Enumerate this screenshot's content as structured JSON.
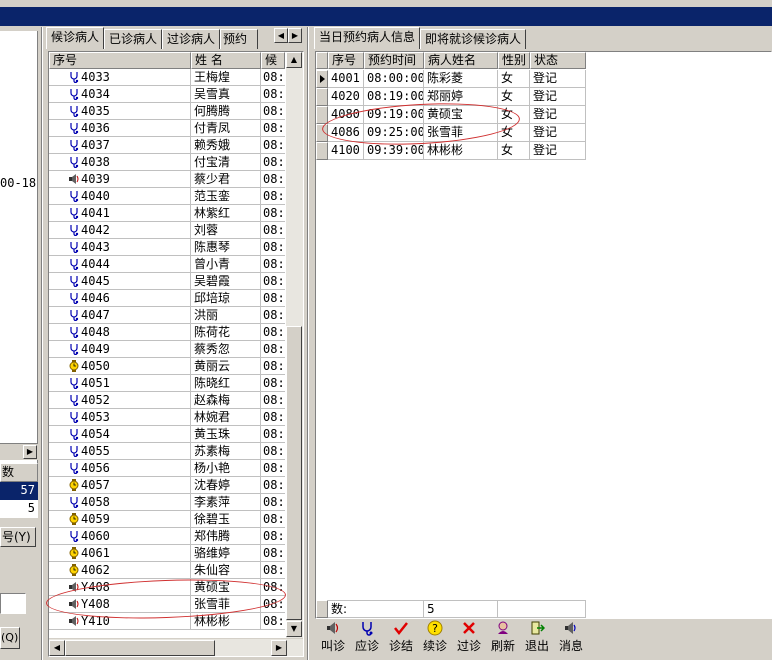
{
  "left_panel": {
    "datetime_fragment": "00-18",
    "count_header": "数",
    "count_value_1": "57",
    "count_value_2": "5",
    "button_1": "号(Y)",
    "button_2": "(Q)"
  },
  "middle": {
    "tabs": [
      "候诊病人",
      "已诊病人",
      "过诊病人",
      "预约"
    ],
    "active_tab": 0,
    "columns": [
      "序号",
      "姓  名",
      "候"
    ],
    "rows": [
      {
        "no": "4033",
        "name": "王梅煌",
        "time": "08:",
        "icon": "stethoscope"
      },
      {
        "no": "4034",
        "name": "吴雪真",
        "time": "08:",
        "icon": "stethoscope"
      },
      {
        "no": "4035",
        "name": "何腾腾",
        "time": "08:",
        "icon": "stethoscope"
      },
      {
        "no": "4036",
        "name": "付青凤",
        "time": "08:",
        "icon": "stethoscope"
      },
      {
        "no": "4037",
        "name": "赖秀娥",
        "time": "08:",
        "icon": "stethoscope"
      },
      {
        "no": "4038",
        "name": "付宝清",
        "time": "08:",
        "icon": "stethoscope"
      },
      {
        "no": "4039",
        "name": "蔡少君",
        "time": "08:",
        "icon": "speaker"
      },
      {
        "no": "4040",
        "name": "范玉銮",
        "time": "08:",
        "icon": "stethoscope"
      },
      {
        "no": "4041",
        "name": "林紫红",
        "time": "08:",
        "icon": "stethoscope"
      },
      {
        "no": "4042",
        "name": "刘蓉",
        "time": "08:",
        "icon": "stethoscope"
      },
      {
        "no": "4043",
        "name": "陈惠琴",
        "time": "08:",
        "icon": "stethoscope"
      },
      {
        "no": "4044",
        "name": "曾小青",
        "time": "08:",
        "icon": "stethoscope"
      },
      {
        "no": "4045",
        "name": "吴碧霞",
        "time": "08:",
        "icon": "stethoscope"
      },
      {
        "no": "4046",
        "name": "邱培琼",
        "time": "08:",
        "icon": "stethoscope"
      },
      {
        "no": "4047",
        "name": "洪丽",
        "time": "08:",
        "icon": "stethoscope"
      },
      {
        "no": "4048",
        "name": "陈荷花",
        "time": "08:",
        "icon": "stethoscope"
      },
      {
        "no": "4049",
        "name": "蔡秀忽",
        "time": "08:",
        "icon": "stethoscope"
      },
      {
        "no": "4050",
        "name": "黄丽云",
        "time": "08:",
        "icon": "watch"
      },
      {
        "no": "4051",
        "name": "陈晓红",
        "time": "08:",
        "icon": "stethoscope"
      },
      {
        "no": "4052",
        "name": "赵森梅",
        "time": "08:",
        "icon": "stethoscope"
      },
      {
        "no": "4053",
        "name": "林婉君",
        "time": "08:",
        "icon": "stethoscope"
      },
      {
        "no": "4054",
        "name": "黄玉珠",
        "time": "08:",
        "icon": "stethoscope"
      },
      {
        "no": "4055",
        "name": "苏素梅",
        "time": "08:",
        "icon": "stethoscope"
      },
      {
        "no": "4056",
        "name": "杨小艳",
        "time": "08:",
        "icon": "stethoscope"
      },
      {
        "no": "4057",
        "name": "沈春婷",
        "time": "08:",
        "icon": "watch"
      },
      {
        "no": "4058",
        "name": "李素萍",
        "time": "08:",
        "icon": "stethoscope"
      },
      {
        "no": "4059",
        "name": "徐碧玉",
        "time": "08:",
        "icon": "watch"
      },
      {
        "no": "4060",
        "name": "郑伟腾",
        "time": "08:",
        "icon": "stethoscope"
      },
      {
        "no": "4061",
        "name": "骆维婷",
        "time": "08:",
        "icon": "watch"
      },
      {
        "no": "4062",
        "name": "朱仙容",
        "time": "08:",
        "icon": "watch"
      },
      {
        "no": "Y408",
        "name": "黄硕宝",
        "time": "08:",
        "icon": "speaker"
      },
      {
        "no": "Y408",
        "name": "张雪菲",
        "time": "08:",
        "icon": "speaker"
      },
      {
        "no": "Y410",
        "name": "林彬彬",
        "time": "08:",
        "icon": "speaker"
      }
    ]
  },
  "right": {
    "tabs": [
      "当日预约病人信息",
      "即将就诊候诊病人"
    ],
    "active_tab": 0,
    "columns": [
      "序号",
      "预约时间",
      "病人姓名",
      "性别",
      "状态"
    ],
    "rows": [
      {
        "no": "4001",
        "time": "08:00:00",
        "name": "陈彩菱",
        "sex": "女",
        "status": "登记",
        "current": true
      },
      {
        "no": "4020",
        "time": "08:19:00",
        "name": "郑丽婷",
        "sex": "女",
        "status": "登记",
        "current": false
      },
      {
        "no": "4080",
        "time": "09:19:00",
        "name": "黄硕宝",
        "sex": "女",
        "status": "登记",
        "current": false
      },
      {
        "no": "4086",
        "time": "09:25:00",
        "name": "张雪菲",
        "sex": "女",
        "status": "登记",
        "current": false
      },
      {
        "no": "4100",
        "time": "09:39:00",
        "name": "林彬彬",
        "sex": "女",
        "status": "登记",
        "current": false
      }
    ],
    "footer_label": "数:",
    "footer_value": "5"
  },
  "toolbar": [
    {
      "label": "叫诊",
      "icon": "speaker-icon",
      "color": "#0000a0"
    },
    {
      "label": "应诊",
      "icon": "stethoscope-icon",
      "color": "#0000a0"
    },
    {
      "label": "诊结",
      "icon": "check-icon",
      "color": "#e00000"
    },
    {
      "label": "续诊",
      "icon": "question-icon",
      "color": "#e0c000"
    },
    {
      "label": "过诊",
      "icon": "x-icon",
      "color": "#e00000"
    },
    {
      "label": "刷新",
      "icon": "refresh-icon",
      "color": "#800080"
    },
    {
      "label": "退出",
      "icon": "exit-icon",
      "color": "#008000"
    },
    {
      "label": "消息",
      "icon": "message-icon",
      "color": "#0000a0"
    }
  ]
}
